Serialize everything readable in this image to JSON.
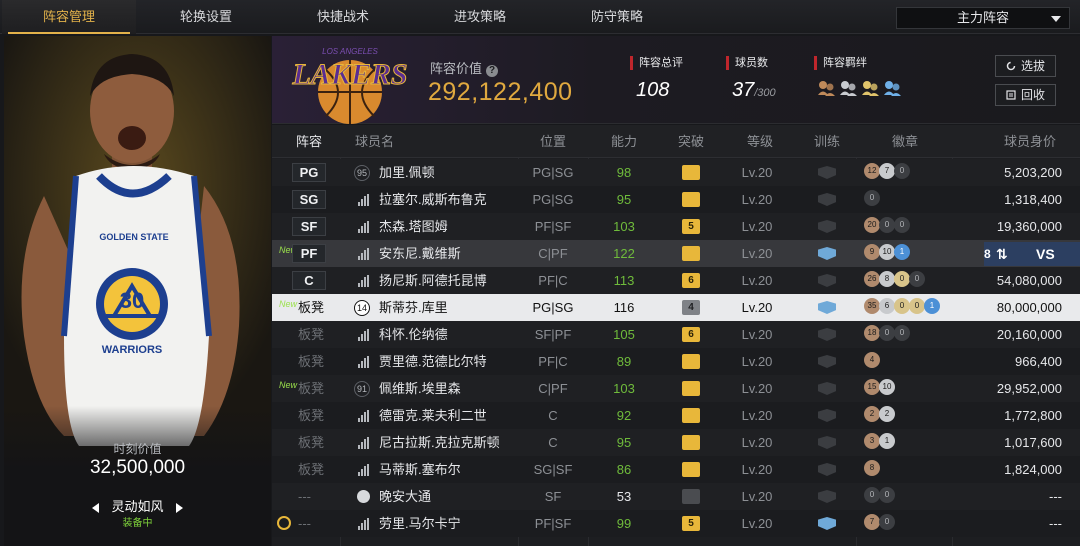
{
  "nav": {
    "tabs": [
      "阵容管理",
      "轮换设置",
      "快捷战术",
      "进攻策略",
      "防守策略"
    ],
    "active_tab": "阵容管理",
    "lineup_select": "主力阵容"
  },
  "player_panel": {
    "jersey_team": "GOLDEN STATE",
    "jersey_number": "30",
    "jersey_name": "WARRIORS",
    "moment_label": "时刻价值",
    "moment_value": "32,500,000",
    "skill_name": "灵动如风",
    "skill_status": "装备中"
  },
  "team_info": {
    "logo_text": "LAKERS",
    "logo_sub": "LOS ANGELES",
    "value_label": "阵容价值",
    "value_help_icon": "?",
    "value": "292,122,400",
    "rating_label": "阵容总评",
    "rating": "108",
    "players_label": "球员数",
    "players": "37",
    "players_max": "/300",
    "bond_label": "阵容羁绊",
    "bond_icons": [
      "bond-icon-bronze",
      "bond-icon-silver",
      "bond-icon-gold",
      "bond-icon-blue"
    ],
    "select_button": "选拔",
    "recycle_button": "回收"
  },
  "table": {
    "headers": [
      "阵容",
      "球员名",
      "位置",
      "能力",
      "突破",
      "等级",
      "训练",
      "徽章",
      "球员身价"
    ],
    "swap_button": {
      "number": "8",
      "vs": "VS"
    },
    "rows": [
      {
        "slot": "PG",
        "bench": false,
        "new": "",
        "icon": "jersey",
        "jersey": "95",
        "name": "加里.佩顿",
        "position": "PG|SG",
        "ability": "98",
        "ability_green": true,
        "breakthrough": "",
        "bt_style": "gold",
        "level": "Lv.20",
        "train": "dark",
        "badges": [
          [
            "bronze",
            "12"
          ],
          [
            "silver",
            "7"
          ],
          [
            "dark",
            "0"
          ]
        ],
        "price": "5,203,200"
      },
      {
        "slot": "SG",
        "bench": false,
        "new": "",
        "icon": "bars",
        "jersey": "",
        "name": "拉塞尔.威斯布鲁克",
        "position": "PG|SG",
        "ability": "95",
        "ability_green": true,
        "breakthrough": "",
        "bt_style": "gold",
        "level": "Lv.20",
        "train": "dark",
        "badges": [
          [
            "dark",
            "0"
          ]
        ],
        "price": "1,318,400"
      },
      {
        "slot": "SF",
        "bench": false,
        "new": "",
        "icon": "bars",
        "jersey": "",
        "name": "杰森.塔图姆",
        "position": "PF|SF",
        "ability": "103",
        "ability_green": true,
        "breakthrough": "5",
        "bt_style": "gold",
        "level": "Lv.20",
        "train": "dark",
        "badges": [
          [
            "bronze",
            "20"
          ],
          [
            "dark",
            "0"
          ],
          [
            "dark",
            "0"
          ]
        ],
        "price": "19,360,000"
      },
      {
        "slot": "PF",
        "bench": false,
        "new": "New",
        "icon": "bars",
        "jersey": "",
        "name": "安东尼.戴维斯",
        "position": "C|PF",
        "ability": "122",
        "ability_green": true,
        "breakthrough": "",
        "bt_style": "gold",
        "level": "Lv.20",
        "train": "blue",
        "badges": [
          [
            "bronze",
            "9"
          ],
          [
            "silver",
            "10"
          ],
          [
            "blue",
            "1"
          ]
        ],
        "price": "",
        "swap": true
      },
      {
        "slot": "C",
        "bench": false,
        "new": "",
        "icon": "bars",
        "jersey": "",
        "name": "扬尼斯.阿德托昆博",
        "position": "PF|C",
        "ability": "113",
        "ability_green": true,
        "breakthrough": "6",
        "bt_style": "gold",
        "level": "Lv.20",
        "train": "dark",
        "badges": [
          [
            "bronze",
            "26"
          ],
          [
            "silver",
            "8"
          ],
          [
            "gold",
            "0"
          ],
          [
            "dark",
            "0"
          ]
        ],
        "price": "54,080,000"
      },
      {
        "slot": "板凳",
        "bench": true,
        "new": "New",
        "icon": "jersey",
        "jersey": "14",
        "name": "斯蒂芬.库里",
        "position": "PG|SG",
        "ability": "116",
        "ability_green": false,
        "breakthrough": "4",
        "bt_style": "grey",
        "level": "Lv.20",
        "train": "blue",
        "badges": [
          [
            "bronze",
            "35"
          ],
          [
            "silver",
            "6"
          ],
          [
            "gold",
            "0"
          ],
          [
            "gold",
            "0"
          ],
          [
            "blue",
            "1"
          ]
        ],
        "price": "80,000,000",
        "selected": true
      },
      {
        "slot": "板凳",
        "bench": true,
        "new": "",
        "icon": "bars",
        "jersey": "",
        "name": "科怀.伦纳德",
        "position": "SF|PF",
        "ability": "105",
        "ability_green": true,
        "breakthrough": "6",
        "bt_style": "gold",
        "level": "Lv.20",
        "train": "dark",
        "badges": [
          [
            "bronze",
            "18"
          ],
          [
            "dark",
            "0"
          ],
          [
            "dark",
            "0"
          ]
        ],
        "price": "20,160,000"
      },
      {
        "slot": "板凳",
        "bench": true,
        "new": "",
        "icon": "bars",
        "jersey": "",
        "name": "贾里德.范德比尔特",
        "position": "PF|C",
        "ability": "89",
        "ability_green": true,
        "breakthrough": "",
        "bt_style": "gold",
        "level": "Lv.20",
        "train": "dark",
        "badges": [
          [
            "bronze",
            "4"
          ]
        ],
        "price": "966,400"
      },
      {
        "slot": "板凳",
        "bench": true,
        "new": "New",
        "icon": "jersey",
        "jersey": "91",
        "name": "佩维斯.埃里森",
        "position": "C|PF",
        "ability": "103",
        "ability_green": true,
        "breakthrough": "",
        "bt_style": "gold",
        "level": "Lv.20",
        "train": "dark",
        "badges": [
          [
            "bronze",
            "15"
          ],
          [
            "silver",
            "10"
          ]
        ],
        "price": "29,952,000"
      },
      {
        "slot": "板凳",
        "bench": true,
        "new": "",
        "icon": "bars",
        "jersey": "",
        "name": "德雷克.莱夫利二世",
        "position": "C",
        "ability": "92",
        "ability_green": true,
        "breakthrough": "",
        "bt_style": "gold",
        "level": "Lv.20",
        "train": "dark",
        "badges": [
          [
            "bronze",
            "2"
          ],
          [
            "silver",
            "2"
          ]
        ],
        "price": "1,772,800"
      },
      {
        "slot": "板凳",
        "bench": true,
        "new": "",
        "icon": "bars",
        "jersey": "",
        "name": "尼古拉斯.克拉克斯顿",
        "position": "C",
        "ability": "95",
        "ability_green": true,
        "breakthrough": "",
        "bt_style": "gold",
        "level": "Lv.20",
        "train": "dark",
        "badges": [
          [
            "bronze",
            "3"
          ],
          [
            "silver",
            "1"
          ]
        ],
        "price": "1,017,600"
      },
      {
        "slot": "板凳",
        "bench": true,
        "new": "",
        "icon": "bars",
        "jersey": "",
        "name": "马蒂斯.塞布尔",
        "position": "SG|SF",
        "ability": "86",
        "ability_green": true,
        "breakthrough": "",
        "bt_style": "gold",
        "level": "Lv.20",
        "train": "dark",
        "badges": [
          [
            "bronze",
            "8"
          ]
        ],
        "price": "1,824,000"
      },
      {
        "slot": "---",
        "bench": true,
        "new": "",
        "icon": "person",
        "jersey": "",
        "name": "晚安大通",
        "position": "SF",
        "ability": "53",
        "ability_green": false,
        "breakthrough": "",
        "bt_style": "dark",
        "level": "Lv.20",
        "train": "dark",
        "badges": [
          [
            "dark",
            "0"
          ],
          [
            "dark",
            "0"
          ]
        ],
        "price": "---"
      },
      {
        "slot": "---",
        "bench": true,
        "new": "",
        "icon": "bars",
        "jersey": "",
        "name": "劳里.马尔卡宁",
        "position": "PF|SF",
        "ability": "99",
        "ability_green": true,
        "breakthrough": "5",
        "bt_style": "gold",
        "level": "Lv.20",
        "train": "blue",
        "badges": [
          [
            "bronze",
            "7"
          ],
          [
            "dark",
            "0"
          ]
        ],
        "price": "---",
        "alarm": true
      }
    ]
  }
}
